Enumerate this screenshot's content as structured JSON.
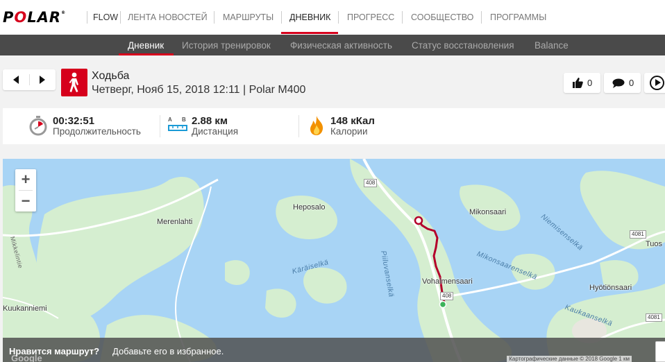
{
  "brand": {
    "logo_letters": [
      "P",
      "O",
      "L",
      "A",
      "R"
    ],
    "mark": "®",
    "product": "FLOW",
    "accent": "#d6001c"
  },
  "topnav": [
    {
      "label": "ЛЕНТА НОВОСТЕЙ"
    },
    {
      "label": "МАРШРУТЫ"
    },
    {
      "label": "ДНЕВНИК",
      "active": true
    },
    {
      "label": "ПРОГРЕСС"
    },
    {
      "label": "СООБЩЕСТВО"
    },
    {
      "label": "ПРОГРАММЫ"
    }
  ],
  "subnav": [
    {
      "label": "Дневник",
      "active": true
    },
    {
      "label": "История тренировок"
    },
    {
      "label": "Физическая активность"
    },
    {
      "label": "Статус восстановления"
    },
    {
      "label": "Balance"
    }
  ],
  "session": {
    "sport_icon": "walking-person-icon",
    "title": "Ходьба",
    "subtitle": "Четверг, Нояб 15, 2018 12:11 | Polar M400"
  },
  "social": {
    "likes": "0",
    "comments": "0"
  },
  "stats": {
    "duration": {
      "value": "00:32:51",
      "label": "Продолжительность",
      "icon": "stopwatch-icon"
    },
    "distance": {
      "value": "2.88 км",
      "label": "Дистанция",
      "icon": "distance-ruler-icon",
      "icon_letters": [
        "A",
        "B"
      ]
    },
    "calories": {
      "value": "148 кКал",
      "label": "Калории",
      "icon": "flame-icon"
    }
  },
  "map": {
    "zoom_in": "+",
    "zoom_out": "−",
    "places": [
      "Heposalo",
      "Merenlahti",
      "Mikonsaari",
      "Vohalmensaari",
      "Kuukanniemi",
      "Hyötiönsaari",
      "Tuos"
    ],
    "waters": [
      "Käräiselkä",
      "Piiluvanselkä",
      "Mikonsaarenselkä",
      "Niemisenselkä",
      "Kaukaanselkä",
      "Mikkelintie"
    ],
    "road_shields": [
      "408",
      "408",
      "4081",
      "4081"
    ],
    "route_color": "#b4002a",
    "google_mark": "Google",
    "copyright": "Картографические данные © 2018 Google   1 км"
  },
  "banner": {
    "question": "Нравится маршрут?",
    "action": "Добавьте его в избранное."
  }
}
